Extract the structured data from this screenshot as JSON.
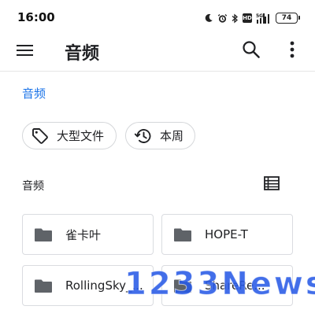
{
  "status_bar": {
    "time": "16:00",
    "network": "5G",
    "battery": "74",
    "hd": "HD"
  },
  "app_bar": {
    "title": "音频"
  },
  "breadcrumb": {
    "label": "音频"
  },
  "chips": [
    {
      "label": "大型文件",
      "icon": "tag-icon"
    },
    {
      "label": "本周",
      "icon": "history-icon"
    }
  ],
  "section": {
    "title": "音频"
  },
  "folders": [
    {
      "name": "雀卡叶"
    },
    {
      "name": "HOPE-T"
    },
    {
      "name": "RollingSky_..."
    },
    {
      "name": "ShareRe..."
    }
  ],
  "watermark": {
    "text": "1233News"
  },
  "colors": {
    "accent": "#1a73e8",
    "folder_icon": "#5f6368",
    "watermark": "#285ae6"
  }
}
